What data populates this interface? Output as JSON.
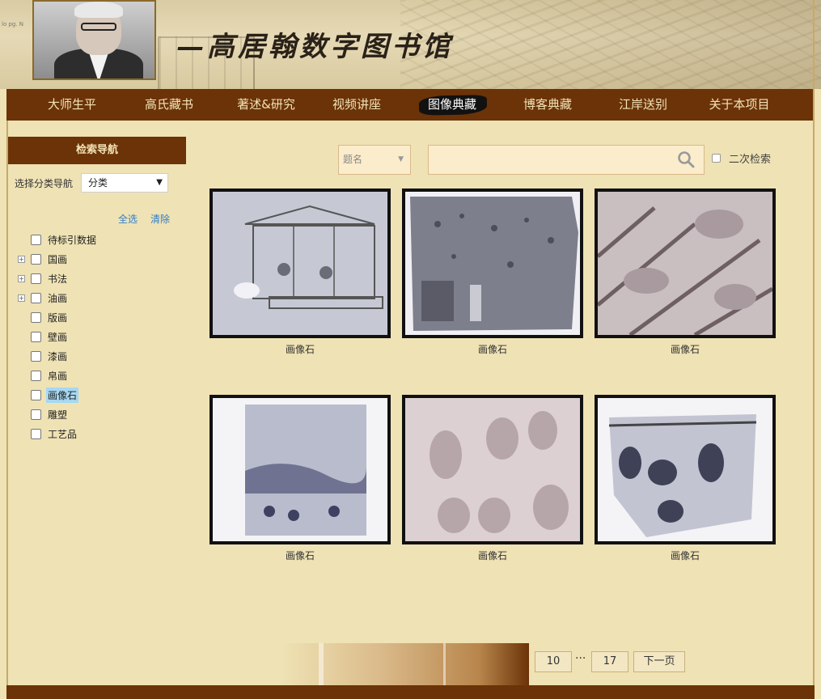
{
  "header": {
    "site_title": "—高居翰数字图书馆",
    "corner_text": "lo pg. N"
  },
  "nav": {
    "items": [
      "大师生平",
      "高氏藏书",
      "著述&研究",
      "视频讲座",
      "图像典藏",
      "博客典藏",
      "江岸送别",
      "关于本项目"
    ],
    "active_index": 4
  },
  "sidebar": {
    "heading": "检索导航",
    "category_label": "选择分类导航",
    "category_value": "分类",
    "select_all": "全选",
    "clear": "清除",
    "tree": [
      {
        "label": "待标引数据",
        "expandable": false,
        "selected": false
      },
      {
        "label": "国画",
        "expandable": true,
        "selected": false
      },
      {
        "label": "书法",
        "expandable": true,
        "selected": false
      },
      {
        "label": "油画",
        "expandable": true,
        "selected": false
      },
      {
        "label": "版画",
        "expandable": false,
        "selected": false
      },
      {
        "label": "壁画",
        "expandable": false,
        "selected": false
      },
      {
        "label": "漆画",
        "expandable": false,
        "selected": false
      },
      {
        "label": "帛画",
        "expandable": false,
        "selected": false
      },
      {
        "label": "画像石",
        "expandable": false,
        "selected": true
      },
      {
        "label": "雕塑",
        "expandable": false,
        "selected": false
      },
      {
        "label": "工艺品",
        "expandable": false,
        "selected": false
      }
    ]
  },
  "search": {
    "field_value": "题名",
    "query": "",
    "secondary_label": "二次检索"
  },
  "results": [
    {
      "caption": "画像石"
    },
    {
      "caption": "画像石"
    },
    {
      "caption": "画像石"
    },
    {
      "caption": "画像石"
    },
    {
      "caption": "画像石"
    },
    {
      "caption": "画像石"
    }
  ],
  "pagination": {
    "current_page": "10",
    "ellipsis": "···",
    "last_page": "17",
    "next_label": "下一页"
  },
  "colors": {
    "nav_bg": "#6b3307",
    "page_bg": "#efe2b4",
    "nav_text": "#f3e3b8",
    "link": "#2f7ec9"
  }
}
